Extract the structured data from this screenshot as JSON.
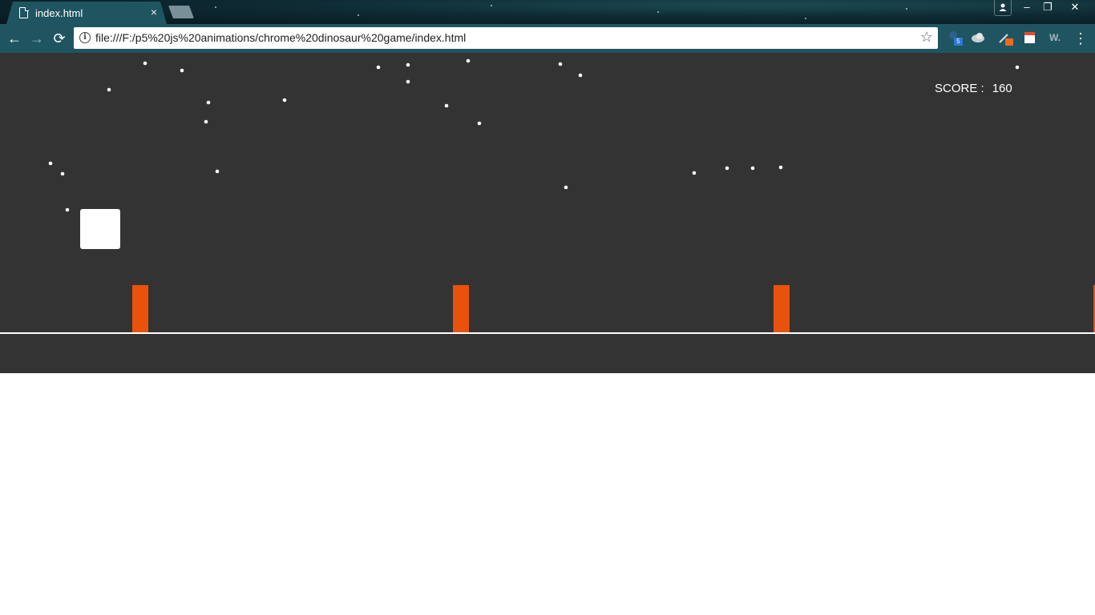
{
  "tab": {
    "title": "index.html",
    "close_glyph": "×"
  },
  "window_controls": {
    "minimize": "–",
    "maximize": "❐",
    "close": "✕"
  },
  "toolbar": {
    "url": "file:///F:/p5%20js%20animations/chrome%20dinosaur%20game/index.html",
    "back_glyph": "←",
    "forward_glyph": "→",
    "reload_glyph": "⟳",
    "bookmark_glyph": "☆",
    "menu_glyph": "⋮",
    "info_glyph": "i",
    "extensions": {
      "badge_count": "5",
      "ext5_label": "W."
    }
  },
  "game": {
    "score_label": "SCORE :",
    "score_value": "160",
    "colors": {
      "background": "#333333",
      "player": "#ffffff",
      "obstacle": "#e8520c",
      "ground": "#ffffff",
      "star": "#ffffff"
    },
    "icons": [
      "player-block",
      "obstacle-pillar",
      "star-dot"
    ]
  }
}
